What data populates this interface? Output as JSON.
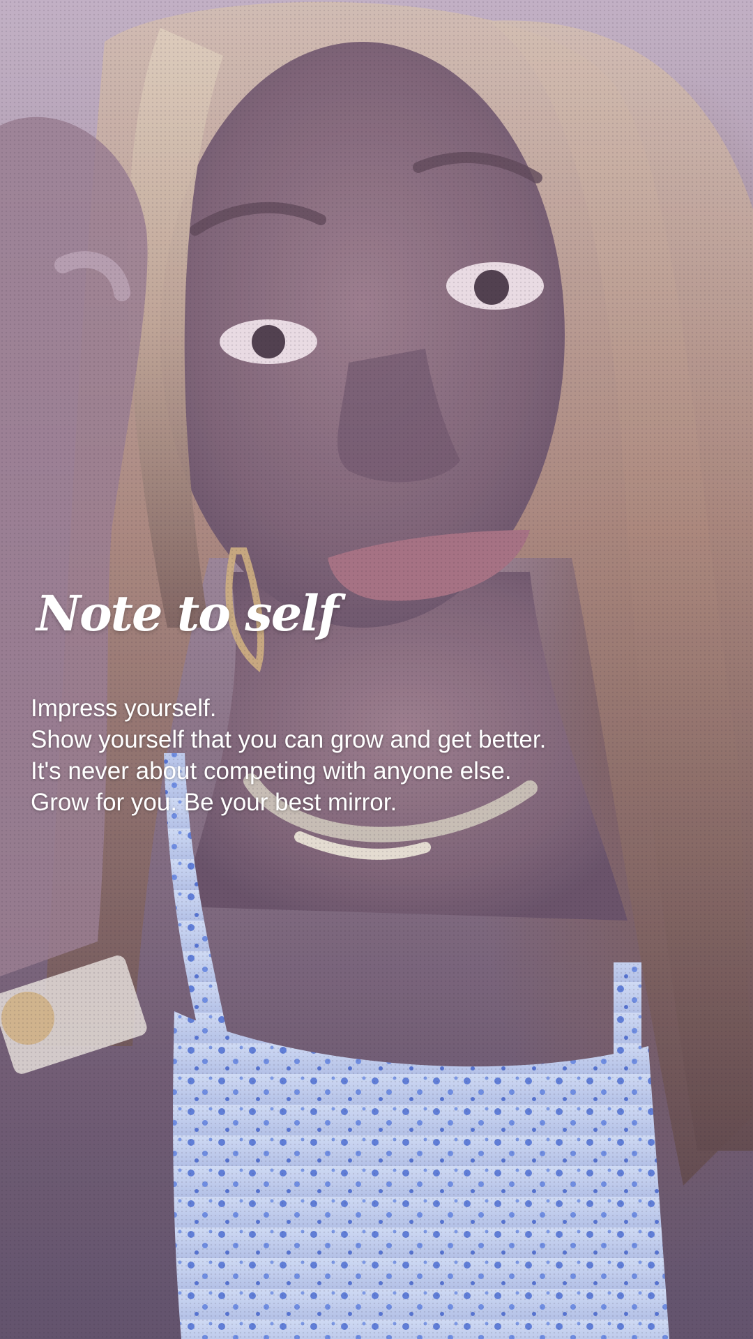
{
  "story": {
    "title": "Note to self",
    "lines": [
      "Impress yourself.",
      "Show yourself that you can grow and get better.",
      "It's never about competing with anyone else.",
      "Grow for you. Be your best mirror."
    ]
  },
  "photo": {
    "subject": "selfie-portrait",
    "accent_colors": [
      "#b9a7bb",
      "#7c6576",
      "#5e4a5e",
      "#8fb0e8",
      "#3f62c8"
    ]
  }
}
